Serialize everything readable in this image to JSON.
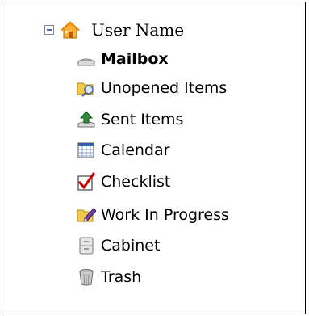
{
  "tree": {
    "root": {
      "expander_icon": "minus-box-icon",
      "icon": "home-icon",
      "label": "User Name"
    },
    "items": [
      {
        "label": "Mailbox",
        "icon": "mailbox-icon",
        "bold": true
      },
      {
        "label": "Unopened Items",
        "icon": "folder-search-icon"
      },
      {
        "label": "Sent Items",
        "icon": "sent-items-icon"
      },
      {
        "label": "Calendar",
        "icon": "calendar-icon"
      },
      {
        "label": "Checklist",
        "icon": "checklist-icon"
      },
      {
        "label": "Work In Progress",
        "icon": "folder-pencil-icon"
      },
      {
        "label": "Cabinet",
        "icon": "cabinet-icon"
      },
      {
        "label": "Trash",
        "icon": "trash-icon"
      }
    ]
  },
  "colors": {
    "border": "#000000",
    "house_roof": "#ff9900",
    "folder": "#f2c94c",
    "checkmark": "#cc0000",
    "calendar_blue": "#2f5fb3",
    "sent_green": "#2e8b3a"
  }
}
